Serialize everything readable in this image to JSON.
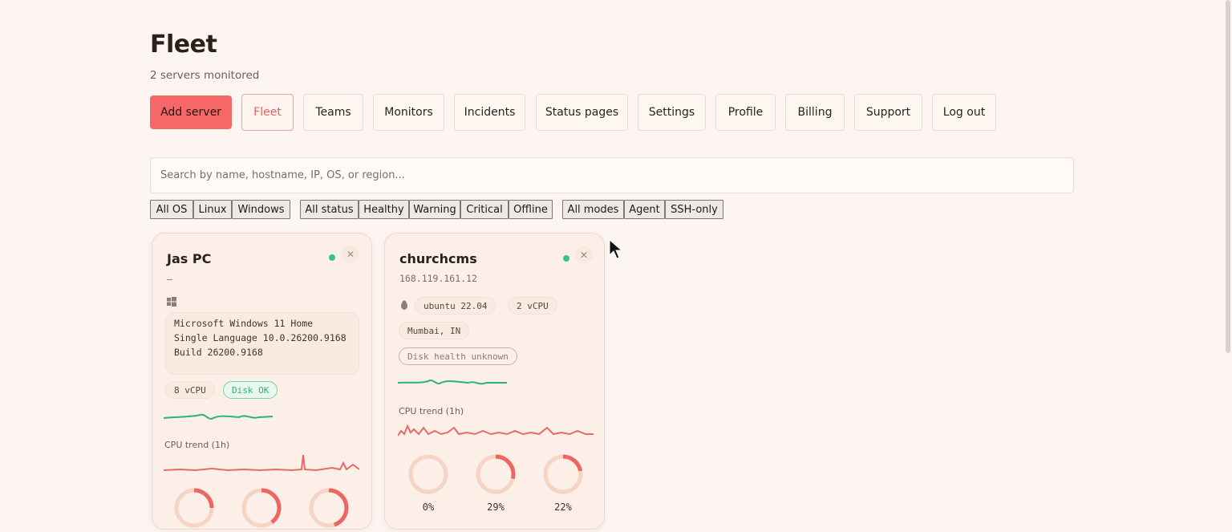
{
  "header": {
    "title": "Fleet",
    "subtitle": "2 servers monitored"
  },
  "nav": {
    "add_server": "Add server",
    "fleet": "Fleet",
    "teams": "Teams",
    "monitors": "Monitors",
    "incidents": "Incidents",
    "status_pages": "Status pages",
    "settings": "Settings",
    "profile": "Profile",
    "billing": "Billing",
    "support": "Support",
    "logout": "Log out"
  },
  "search": {
    "placeholder": "Search by name, hostname, IP, OS, or region..."
  },
  "filters": {
    "os": [
      "All OS",
      "Linux",
      "Windows"
    ],
    "status": [
      "All status",
      "Healthy",
      "Warning",
      "Critical",
      "Offline"
    ],
    "modes": [
      "All modes",
      "Agent",
      "SSH-only"
    ]
  },
  "servers": [
    {
      "name": "Jas PC",
      "host": "–",
      "os_icon": "windows-icon",
      "os_text": "Microsoft Windows 11 Home Single Language 10.0.26200.9168 Build 26200.9168",
      "vcpu": "8 vCPU",
      "disk": "Disk OK",
      "trend_label": "CPU trend (1h)",
      "status_color": "#36c57c",
      "gauges": [
        25,
        40,
        45
      ]
    },
    {
      "name": "churchcms",
      "host": "168.119.161.12",
      "os_icon": "linux-icon",
      "os_text": "ubuntu 22.04",
      "vcpu": "2 vCPU",
      "region": "Mumbai, IN",
      "disk": "Disk health unknown",
      "trend_label": "CPU trend (1h)",
      "status_color": "#36c57c",
      "gauges": [
        0,
        29,
        22
      ],
      "gauge_labels": [
        "0%",
        "29%",
        "22%"
      ]
    }
  ],
  "colors": {
    "accent": "#f46868",
    "healthy": "#36c57c"
  }
}
